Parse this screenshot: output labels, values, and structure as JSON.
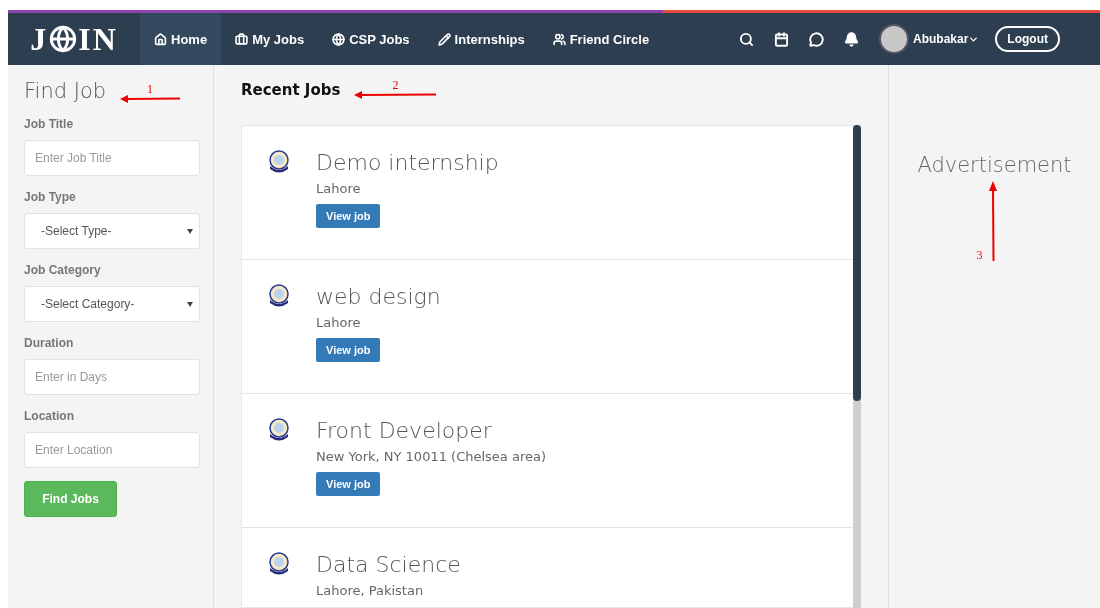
{
  "navbar": {
    "logo": {
      "before": "J",
      "after": "IN"
    },
    "links": [
      {
        "label": "Home",
        "selected": true
      },
      {
        "label": "My Jobs",
        "selected": false
      },
      {
        "label": "CSP Jobs",
        "selected": false
      },
      {
        "label": "Internships",
        "selected": false
      },
      {
        "label": "Friend Circle",
        "selected": false
      }
    ],
    "user": "Abubakar",
    "logout": "Logout"
  },
  "sidebar": {
    "title": "Find Job",
    "annotation": "1",
    "fields": [
      {
        "label": "Job Title",
        "kind": "input",
        "placeholder": "Enter Job Title"
      },
      {
        "label": "Job Type",
        "kind": "select",
        "value": "-Select Type-"
      },
      {
        "label": "Job Category",
        "kind": "select",
        "value": "-Select Category-"
      },
      {
        "label": "Duration",
        "kind": "input",
        "placeholder": "Enter in Days"
      },
      {
        "label": "Location",
        "kind": "input",
        "placeholder": "Enter Location"
      }
    ],
    "button": "Find Jobs"
  },
  "main": {
    "title": "Recent Jobs",
    "annotation": "2",
    "jobs": [
      {
        "title": "Demo internship",
        "location": "Lahore",
        "button": "View job"
      },
      {
        "title": "web design",
        "location": "Lahore",
        "button": "View job"
      },
      {
        "title": "Front Developer",
        "location": "New York, NY 10011 (Chelsea area)",
        "button": "View job"
      },
      {
        "title": "Data Science",
        "location": "Lahore, Pakistan"
      }
    ]
  },
  "aside": {
    "title": "Advertisement",
    "annotation": "3"
  }
}
